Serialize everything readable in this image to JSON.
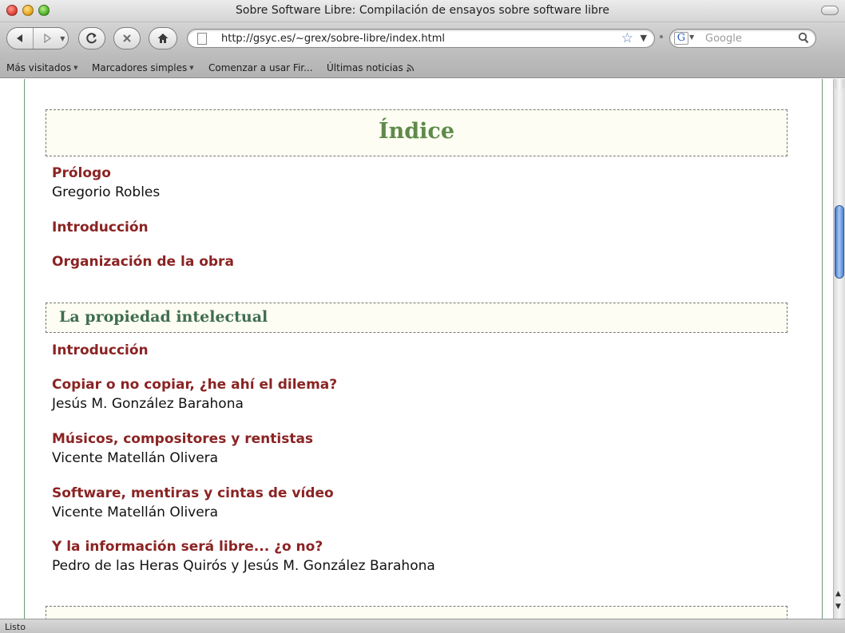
{
  "window": {
    "title": "Sobre Software Libre: Compilación de ensayos sobre software libre"
  },
  "toolbar": {
    "url": "http://gsyc.es/~grex/sobre-libre/index.html",
    "search_placeholder": "Google"
  },
  "bookmarks": [
    {
      "label": "Más visitados",
      "dropdown": true
    },
    {
      "label": "Marcadores simples",
      "dropdown": true
    },
    {
      "label": "Comenzar a usar Fir...",
      "dropdown": false
    },
    {
      "label": "Últimas noticias",
      "dropdown": false
    }
  ],
  "content": {
    "index_heading": "Índice",
    "front_entries": [
      {
        "title": "Prólogo",
        "author": "Gregorio Robles"
      },
      {
        "title": "Introducción",
        "author": ""
      },
      {
        "title": "Organización de la obra",
        "author": ""
      }
    ],
    "section1": {
      "heading": "La propiedad intelectual",
      "entries": [
        {
          "title": "Introducción",
          "author": ""
        },
        {
          "title": "Copiar o no copiar, ¿he ahí el dilema?",
          "author": "Jesús M. González Barahona"
        },
        {
          "title": "Músicos, compositores y rentistas",
          "author": "Vicente Matellán Olivera"
        },
        {
          "title": "Software, mentiras y cintas de vídeo",
          "author": "Vicente Matellán Olivera"
        },
        {
          "title": "Y la información será libre... ¿o no?",
          "author": "Pedro de las Heras Quirós y Jesús M. González Barahona"
        }
      ]
    }
  },
  "status": {
    "text": "Listo"
  },
  "colors": {
    "link": "#8b2323",
    "heading_green": "#5f8a4a",
    "section_green": "#3f6e4f",
    "box_bg": "#fdfdf3",
    "column_border": "#6f9a6f"
  }
}
